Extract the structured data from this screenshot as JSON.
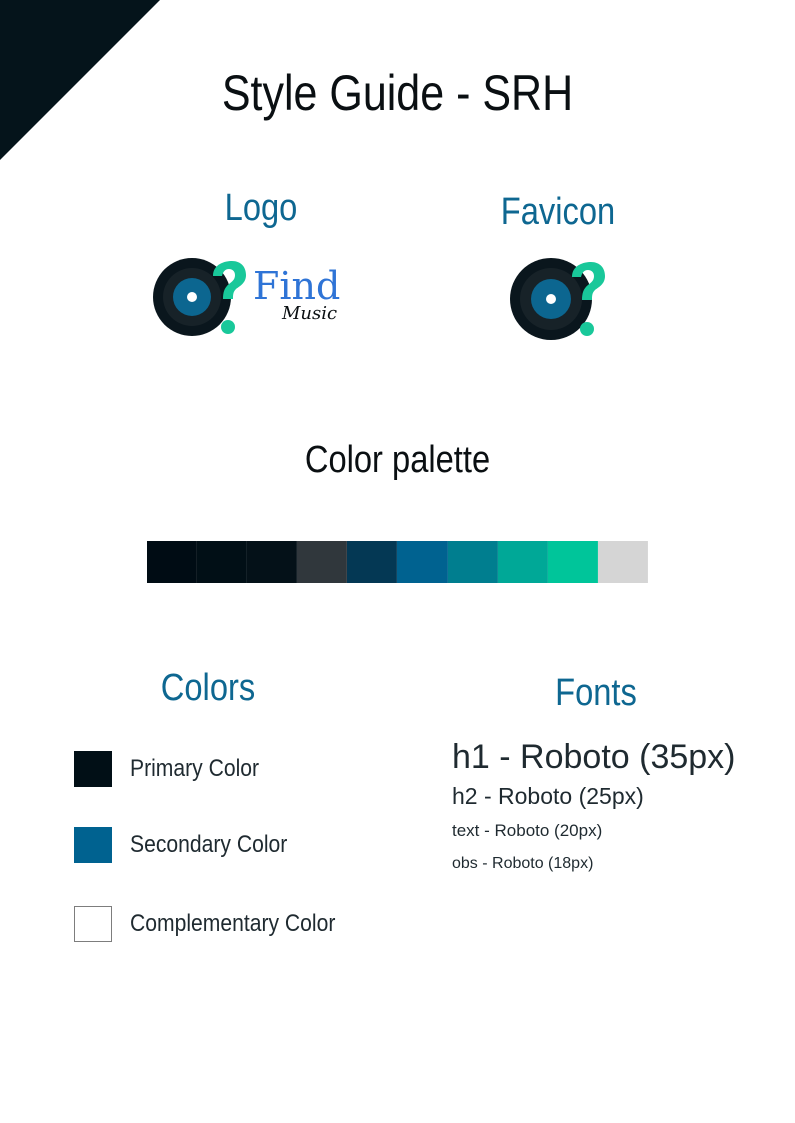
{
  "page": {
    "title": "Style Guide - SRH"
  },
  "sections": {
    "logo_title": "Logo",
    "favicon_title": "Favicon",
    "palette_title": "Color palette",
    "colors_title": "Colors",
    "fonts_title": "Fonts"
  },
  "logo": {
    "wordmark": "Find",
    "subtext": "Music"
  },
  "palette": [
    {
      "color": "#000c14"
    },
    {
      "color": "#010f16"
    },
    {
      "color": "#041118"
    },
    {
      "color": "#30373c"
    },
    {
      "color": "#043854"
    },
    {
      "color": "#006290"
    },
    {
      "color": "#007e8f"
    },
    {
      "color": "#00a897"
    },
    {
      "color": "#00c59a"
    },
    {
      "color": "#d5d5d5"
    }
  ],
  "legend": [
    {
      "label": "Primary Color",
      "color": "#010f16"
    },
    {
      "label": "Secondary Color",
      "color": "#006290"
    },
    {
      "label": "Complementary Color",
      "color": "#ffffff"
    }
  ],
  "fonts": [
    {
      "label": "h1 - Roboto (35px)"
    },
    {
      "label": "h2 - Roboto (25px)"
    },
    {
      "label": "text - Roboto (20px)"
    },
    {
      "label": "obs - Roboto (18px)"
    }
  ],
  "icons": {
    "logo_mark": "vinyl-record-question-icon",
    "favicon": "vinyl-record-question-icon"
  },
  "colors": {
    "corner": "#05141b",
    "accent": "#0e6791",
    "question": "#19c89a"
  }
}
